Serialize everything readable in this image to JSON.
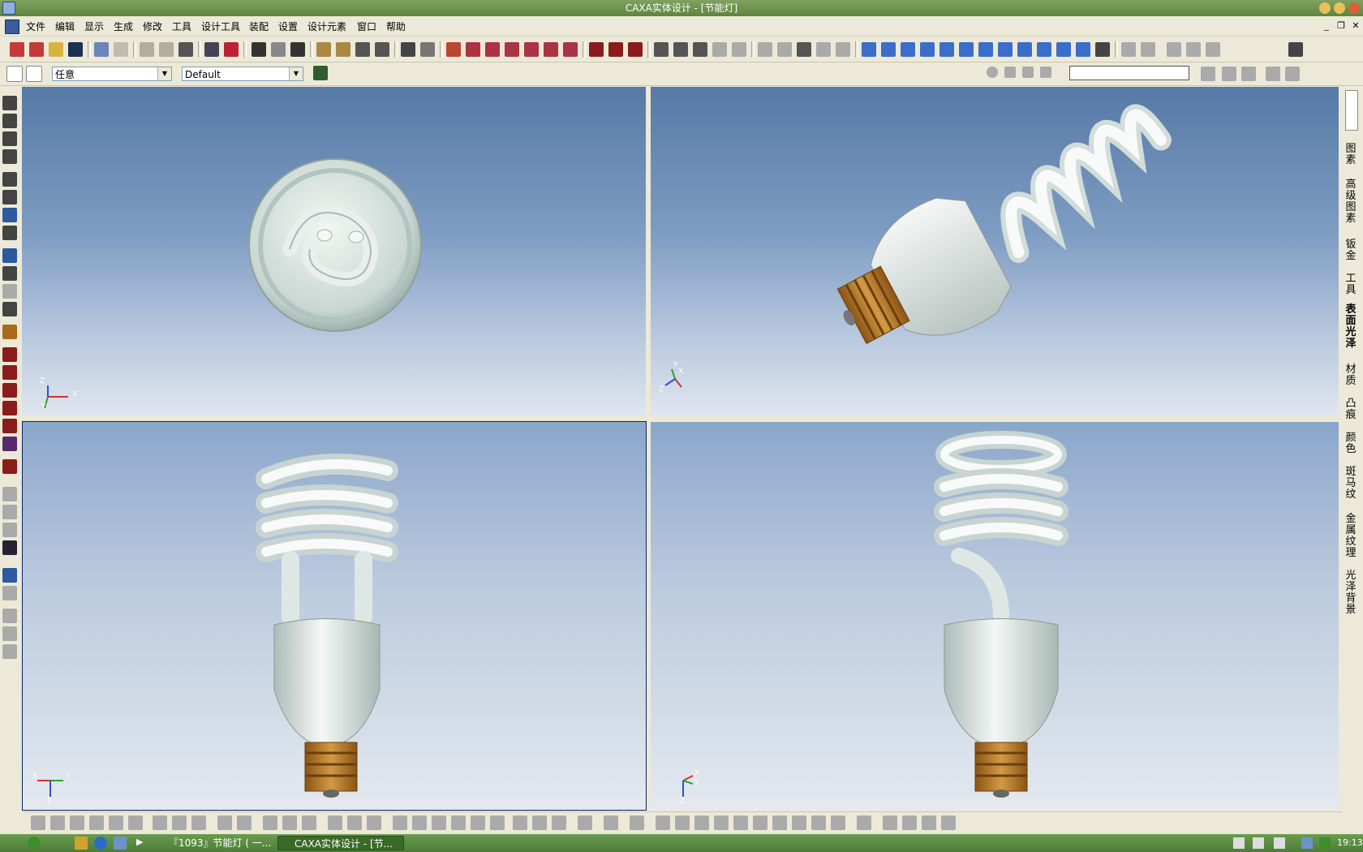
{
  "window": {
    "title": "CAXA实体设计 - [节能灯]"
  },
  "menu": [
    "文件",
    "编辑",
    "显示",
    "生成",
    "修改",
    "工具",
    "设计工具",
    "装配",
    "设置",
    "设计元素",
    "窗口",
    "帮助"
  ],
  "mdi_buttons": [
    "_",
    "❐",
    "✕"
  ],
  "selection_filter": {
    "value": "任意"
  },
  "configuration": {
    "value": "Default"
  },
  "right_tabs": [
    "图素",
    "高级图素",
    "钣金",
    "工具",
    "表面光泽",
    "材质",
    "凸痕",
    "颜色",
    "斑马纹",
    "金属纹理",
    "光泽背景"
  ],
  "viewports": {
    "top_left": {
      "axes": [
        "Z",
        "X",
        "Y"
      ]
    },
    "top_right": {
      "axes": [
        "X",
        "Y",
        "Z"
      ]
    },
    "bottom_left": {
      "axes": [
        "X",
        "Y",
        "Z"
      ]
    },
    "bottom_right": {
      "axes": [
        "X",
        "Y",
        "Z"
      ]
    }
  },
  "taskbar": {
    "tasks": [
      "『1093』节能灯 ( 一...",
      "CAXA实体设计 - [节..."
    ],
    "clock": "19:13"
  },
  "colors": {
    "viewport_top": "#5679a6",
    "viewport_bottom": "#dfe6ef",
    "base": "#b87a2a",
    "bulb": "#e4eae6",
    "title": "#5f8440"
  }
}
